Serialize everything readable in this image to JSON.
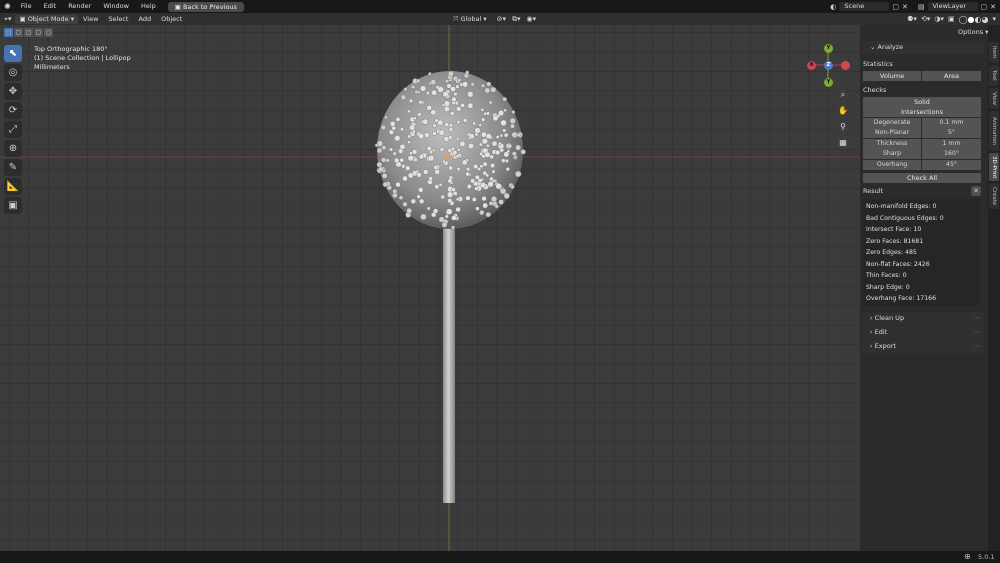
{
  "topbar": {
    "menus": [
      "File",
      "Edit",
      "Render",
      "Window",
      "Help"
    ],
    "back_button": "Back to Previous",
    "scene": "Scene",
    "view_layer": "ViewLayer"
  },
  "header": {
    "mode": "Object Mode",
    "menus": [
      "View",
      "Select",
      "Add",
      "Object"
    ],
    "transform_orientation": "Global",
    "options": "Options"
  },
  "overlay": {
    "view_name": "Top Orthographic 180°",
    "collection": "(1) Scene Collection | Lollipop",
    "units": "Millimeters"
  },
  "panel": {
    "title": "Analyze",
    "statistics": "Statistics",
    "volume": "Volume",
    "area": "Area",
    "checks": "Checks",
    "solid": "Solid",
    "intersections": "Intersections",
    "props": [
      {
        "key": "Degenerate",
        "value": "0.1 mm"
      },
      {
        "key": "Non-Planar",
        "value": "5°"
      },
      {
        "key": "Thickness",
        "value": "1 mm"
      },
      {
        "key": "Sharp",
        "value": "160°"
      },
      {
        "key": "Overhang",
        "value": "45°"
      }
    ],
    "check_all": "Check All",
    "result": "Result",
    "results": [
      "Non-manifold Edges: 0",
      "Bad Contiguous Edges: 0",
      "Intersect Face: 10",
      "Zero Faces: 81681",
      "Zero Edges: 485",
      "Non-flat Faces: 2426",
      "Thin Faces: 0",
      "Sharp Edge: 0",
      "Overhang Face: 17166"
    ],
    "sections": [
      "Clean Up",
      "Edit",
      "Export"
    ]
  },
  "tabs": [
    "Item",
    "Tool",
    "View",
    "Animation",
    "3D-Print",
    "Create"
  ],
  "gizmo": {
    "x": "X",
    "y": "Y",
    "z": "Z"
  },
  "status": {
    "version": "5.0.1"
  }
}
